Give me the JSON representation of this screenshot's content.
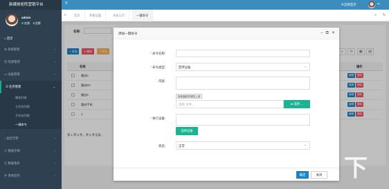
{
  "app": {
    "title": "新媒体矩阵营销平台",
    "fullscreen_label": "全屏显示"
  },
  "profile": {
    "name": "admin",
    "status": "在线",
    "logout": "注销"
  },
  "sidebar": {
    "home": "首页",
    "items": [
      {
        "label": "系统管理"
      },
      {
        "label": "资源管理"
      },
      {
        "label": "设备管理"
      },
      {
        "label": "任务管理"
      },
      {
        "label": "监控告警"
      },
      {
        "label": "数据存储"
      },
      {
        "label": "数据报表"
      },
      {
        "label": "系统监控"
      }
    ],
    "task_sub": [
      "脚本列表",
      "主任务列表",
      "子任务列表",
      "一键命令"
    ]
  },
  "tabs": [
    "首页",
    "参数设置",
    "添加公告",
    "一键命令"
  ],
  "list": {
    "search_label": "名称:",
    "buttons": [
      "添加",
      "删除",
      "导出"
    ],
    "columns": {
      "name": "名称",
      "op": "操作"
    },
    "rows": [
      "重启2",
      "重启EC",
      "重启2",
      "重启手机",
      "1"
    ],
    "row_actions": {
      "edit": "编辑",
      "delete": "删除"
    },
    "pager_text": "第 1 到 5 条，共 5 条记录。"
  },
  "modal": {
    "title": "添加一键命令",
    "fields": {
      "name_label": "命令名称:",
      "type_label": "命令类型:",
      "type_value": "回传设备",
      "content_label": "内容:",
      "upload_tag": "拟安装软件请先上传",
      "upload_placeholder": "选择 文件...",
      "upload_button": "选择 ...",
      "device_label": "执行设备:",
      "choose_device_button": "选择设备",
      "status_label": "状态:",
      "status_value": "正常"
    },
    "ok": "确定",
    "close": "关闭"
  },
  "colors": {
    "sidebar": "#2f4050",
    "topbar": "#3c8dbc",
    "primary": "#1c84c6",
    "success": "#1ab394",
    "danger": "#ed5565",
    "warning": "#f8ac59"
  }
}
